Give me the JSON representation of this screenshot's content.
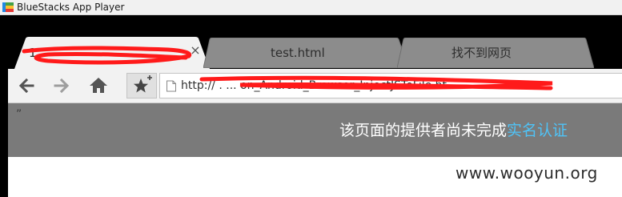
{
  "window": {
    "title": "BlueStacks App Player",
    "icon": "bluestacks-logo-icon"
  },
  "tabs": [
    {
      "label": "1",
      "active": true,
      "has_close": true,
      "close_glyph": "×",
      "redacted": true
    },
    {
      "label": "test.html",
      "active": false
    },
    {
      "label": "找不到网页",
      "active": false
    }
  ],
  "toolbar": {
    "back_icon": "arrow-left-icon",
    "forward_icon": "arrow-right-icon",
    "home_icon": "home-icon",
    "bookmark_icon": "star-plus-icon",
    "page_icon": "page-icon",
    "url": "http://                              .                     ...         on_Android_Browser_InjectJSToFile.ht",
    "url_redacted": true
  },
  "page": {
    "quote_mark": "”",
    "banner_text": "该页面的提供者尚未完成",
    "banner_link": "实名认证",
    "banner_bg": "#7a7a7a",
    "link_color": "#4fc3f7"
  },
  "watermark": "www.wooyun.org",
  "colors": {
    "redaction": "#ff1a1a",
    "active_tab": "#f2f2f2",
    "inactive_tab": "#8c8c8c"
  }
}
